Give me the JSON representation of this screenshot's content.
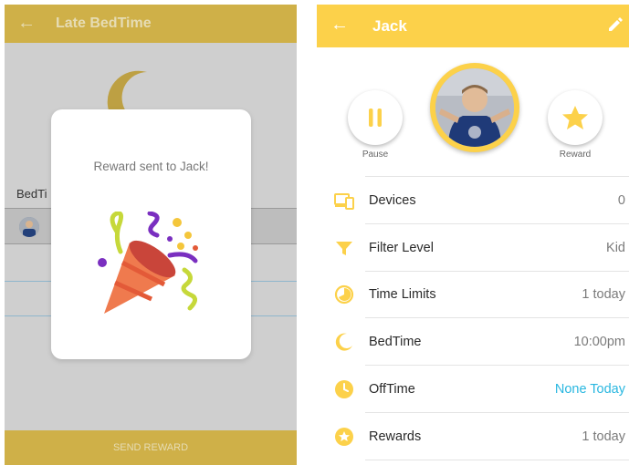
{
  "left_screen": {
    "title": "Late BedTime",
    "section_label": "BedTi",
    "dialog": {
      "message": "Reward sent to Jack!"
    },
    "bottom_button": "SEND REWARD"
  },
  "right_screen": {
    "title": "Jack",
    "actions": {
      "pause_label": "Pause",
      "reward_label": "Reward"
    },
    "rows": [
      {
        "icon": "devices-icon",
        "label": "Devices",
        "value": "0"
      },
      {
        "icon": "filter-icon",
        "label": "Filter Level",
        "value": "Kid"
      },
      {
        "icon": "timer-icon",
        "label": "Time Limits",
        "value": "1 today"
      },
      {
        "icon": "moon-icon",
        "label": "BedTime",
        "value": "10:00pm"
      },
      {
        "icon": "clock-icon",
        "label": "OffTime",
        "value": "None Today"
      },
      {
        "icon": "star-badge-icon",
        "label": "Rewards",
        "value": "1 today"
      }
    ]
  },
  "colors": {
    "accent_yellow": "#fcd14a",
    "dimmed_yellow": "#cfb048",
    "link_blue": "#29b7e0"
  }
}
